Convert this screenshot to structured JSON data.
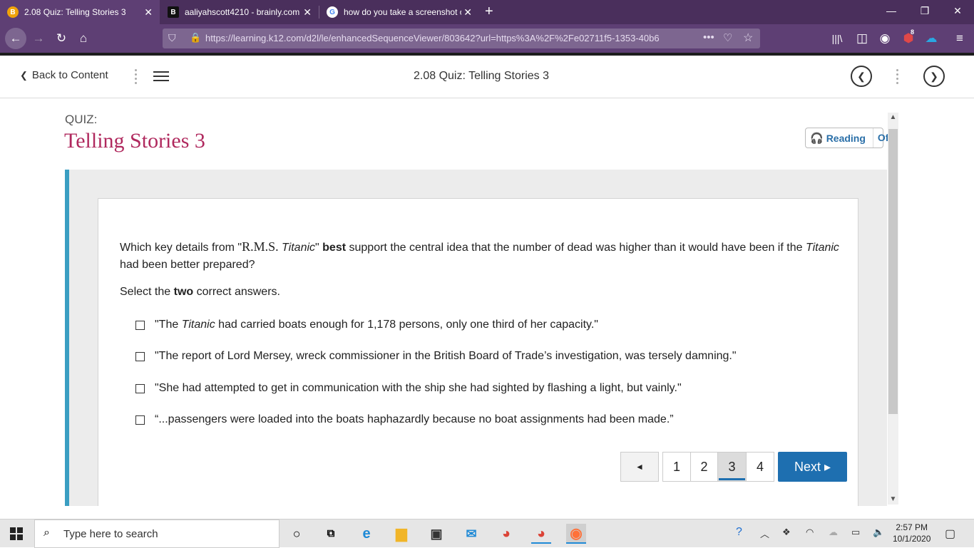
{
  "browser": {
    "tabs": [
      {
        "title": "2.08 Quiz: Telling Stories 3",
        "favicon": "B"
      },
      {
        "title": "aaliyahscott4210 - brainly.com",
        "favicon": "B"
      },
      {
        "title": "how do you take a screenshot o",
        "favicon": "G"
      }
    ],
    "url": "https://learning.k12.com/d2l/le/enhancedSequenceViewer/803642?url=https%3A%2F%2Fe02711f5-1353-40b6",
    "addon_badge": "8"
  },
  "app": {
    "back_label": "Back to Content",
    "title": "2.08 Quiz: Telling Stories 3"
  },
  "quiz": {
    "label": "QUIZ:",
    "title": "Telling Stories 3",
    "reading_label": "Reading",
    "reading_state": "Off",
    "question": {
      "part1": "Which key details from \"",
      "source": "R.M.S.",
      "source_italic": "Titanic",
      "part2": "\" ",
      "emphasis": "best",
      "part3": " support the central idea that the number of dead was higher than it would have been if the ",
      "italic2": "Titanic",
      "part4": " had been better prepared?"
    },
    "instruction": {
      "pre": "Select the ",
      "bold": "two",
      "post": " correct answers."
    },
    "options": [
      {
        "pre": "\"The ",
        "italic": "Titanic",
        "post": " had carried boats enough for 1,178 persons, only one third of her capacity.\""
      },
      {
        "pre": "\"The report of Lord Mersey, wreck commissioner in the British Board of Trade’s investigation, was tersely damning.\"",
        "italic": "",
        "post": ""
      },
      {
        "pre": "\"She had attempted to get in communication with the ship she had sighted by flashing a light, but vainly.\"",
        "italic": "",
        "post": ""
      },
      {
        "pre": "“...passengers were loaded into the boats haphazardly because no boat assignments had been made.”",
        "italic": "",
        "post": ""
      }
    ],
    "pager": {
      "prev": "◄",
      "pages": [
        "1",
        "2",
        "3",
        "4"
      ],
      "current_page": "3",
      "next_label": "Next ▸"
    }
  },
  "taskbar": {
    "search_placeholder": "Type here to search",
    "time": "2:57 PM",
    "date": "10/1/2020"
  },
  "colors": {
    "accent": "#b0295e",
    "brand_blue": "#1e6fb0",
    "left_bar": "#3a9ec2",
    "tab_bar": "#4a2f5c"
  }
}
